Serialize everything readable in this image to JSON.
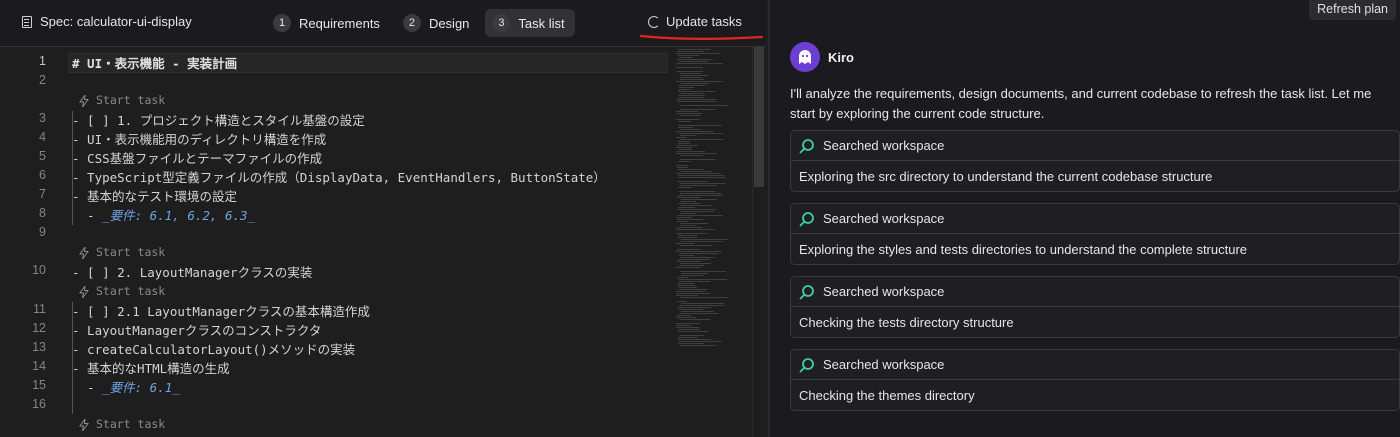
{
  "header": {
    "spec_title": "Spec: calculator-ui-display",
    "tabs": [
      {
        "num": "1",
        "label": "Requirements"
      },
      {
        "num": "2",
        "label": "Design"
      },
      {
        "num": "3",
        "label": "Task list"
      }
    ],
    "update_tasks": "Update tasks"
  },
  "editor": {
    "lens_label": "Start task",
    "lines": {
      "l1": "# UI・表示機能 - 実装計画",
      "l3": "- [ ] 1. プロジェクト構造とスタイル基盤の設定",
      "l4": "  - UI・表示機能用のディレクトリ構造を作成",
      "l5": "  - CSS基盤ファイルとテーマファイルの作成",
      "l6": "  - TypeScript型定義ファイルの作成（DisplayData, EventHandlers, ButtonState）",
      "l7": "  - 基本的なテスト環境の設定",
      "l8_prefix": "  - ",
      "l8": "_要件: 6.1, 6.2, 6.3_",
      "l10": "- [ ] 2. LayoutManagerクラスの実装",
      "l11": "  - [ ] 2.1 LayoutManagerクラスの基本構造作成",
      "l12": "  - LayoutManagerクラスのコンストラクタ",
      "l13": "  - createCalculatorLayout()メソッドの実装",
      "l14": "  - 基本的なHTML構造の生成",
      "l15_prefix": "  - ",
      "l15": "_要件: 6.1_"
    },
    "line_numbers": [
      "1",
      "2",
      "3",
      "4",
      "5",
      "6",
      "7",
      "8",
      "9",
      "10",
      "11",
      "12",
      "13",
      "14",
      "15",
      "16"
    ]
  },
  "chat": {
    "refresh_plan": "Refresh plan",
    "agent_name": "Kiro",
    "message": "I'll analyze the requirements, design documents, and current codebase to refresh the task list. Let me start by exploring the current code structure.",
    "cards": [
      {
        "title": "Searched workspace",
        "body": "Exploring the src directory to understand the current codebase structure"
      },
      {
        "title": "Searched workspace",
        "body": "Exploring the styles and tests directories to understand the complete structure"
      },
      {
        "title": "Searched workspace",
        "body": "Checking the tests directory structure"
      },
      {
        "title": "Searched workspace",
        "body": "Checking the themes directory"
      }
    ]
  },
  "colors": {
    "accent": "#6b3fd1",
    "search_icon": "#3fcf9a",
    "annotation": "#e0262b"
  }
}
